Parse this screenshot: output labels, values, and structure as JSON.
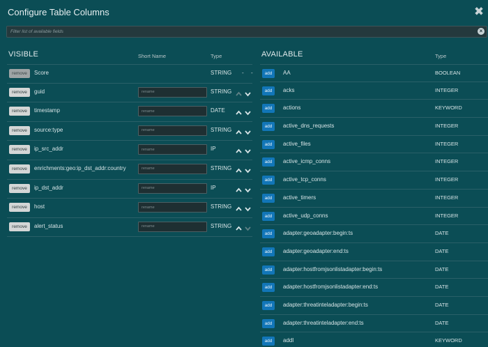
{
  "dialog": {
    "title": "Configure Table Columns",
    "filter_placeholder": "Filter list of available fields"
  },
  "visible": {
    "heading": "VISIBLE",
    "col_short_name": "Short Name",
    "col_type": "Type",
    "remove_label": "remove",
    "rename_placeholder": "rename",
    "rows": [
      {
        "name": "Score",
        "type": "STRING",
        "editable": false,
        "up": false,
        "down": false
      },
      {
        "name": "guid",
        "type": "STRING",
        "editable": true,
        "up": false,
        "down": true
      },
      {
        "name": "timestamp",
        "type": "DATE",
        "editable": true,
        "up": true,
        "down": true
      },
      {
        "name": "source:type",
        "type": "STRING",
        "editable": true,
        "up": true,
        "down": true
      },
      {
        "name": "ip_src_addr",
        "type": "IP",
        "editable": true,
        "up": true,
        "down": true
      },
      {
        "name": "enrichments:geo:ip_dst_addr:country",
        "type": "STRING",
        "editable": true,
        "up": true,
        "down": true
      },
      {
        "name": "ip_dst_addr",
        "type": "IP",
        "editable": true,
        "up": true,
        "down": true
      },
      {
        "name": "host",
        "type": "STRING",
        "editable": true,
        "up": true,
        "down": true
      },
      {
        "name": "alert_status",
        "type": "STRING",
        "editable": true,
        "up": true,
        "down": false
      }
    ]
  },
  "available": {
    "heading": "AVAILABLE",
    "col_type": "Type",
    "add_label": "add",
    "rows": [
      {
        "name": "AA",
        "type": "BOOLEAN"
      },
      {
        "name": "acks",
        "type": "INTEGER"
      },
      {
        "name": "actions",
        "type": "KEYWORD"
      },
      {
        "name": "active_dns_requests",
        "type": "INTEGER"
      },
      {
        "name": "active_files",
        "type": "INTEGER"
      },
      {
        "name": "active_icmp_conns",
        "type": "INTEGER"
      },
      {
        "name": "active_tcp_conns",
        "type": "INTEGER"
      },
      {
        "name": "active_timers",
        "type": "INTEGER"
      },
      {
        "name": "active_udp_conns",
        "type": "INTEGER"
      },
      {
        "name": "adapter:geoadapter:begin:ts",
        "type": "DATE"
      },
      {
        "name": "adapter:geoadapter:end:ts",
        "type": "DATE"
      },
      {
        "name": "adapter:hostfromjsonlistadapter:begin:ts",
        "type": "DATE"
      },
      {
        "name": "adapter:hostfromjsonlistadapter:end:ts",
        "type": "DATE"
      },
      {
        "name": "adapter:threatinteladapter:begin:ts",
        "type": "DATE"
      },
      {
        "name": "adapter:threatinteladapter:end:ts",
        "type": "DATE"
      },
      {
        "name": "addl",
        "type": "KEYWORD"
      }
    ]
  },
  "colors": {
    "background": "#0b4d55",
    "add_button": "#1276b8",
    "remove_button": "#d4d6d6",
    "arrow_active": "#d7e4e6",
    "arrow_disabled": "#5f8186"
  },
  "icons": {
    "close": "close-icon",
    "clear": "clear-icon",
    "move_up": "chevron-up-icon",
    "move_down": "chevron-down-icon"
  }
}
